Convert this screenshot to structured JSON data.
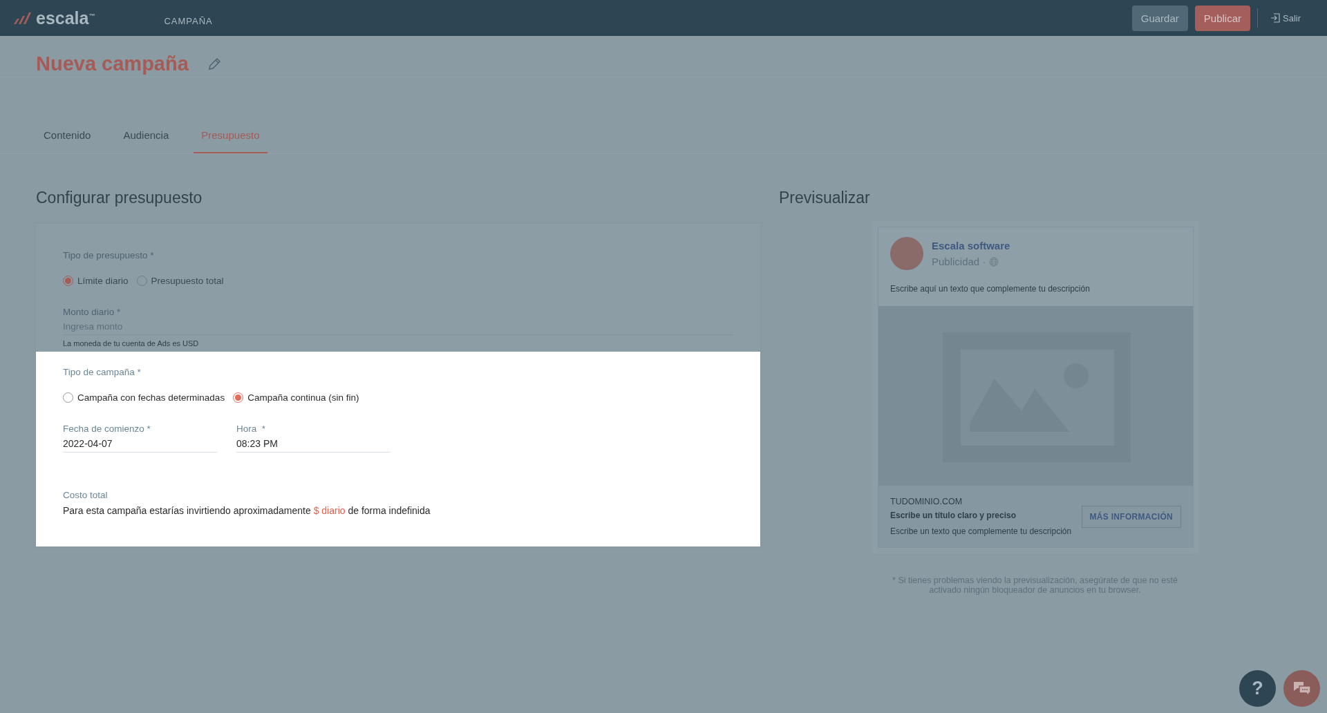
{
  "header": {
    "logo": "escala$^{™}$",
    "section": "CAMPAÑA",
    "buttons": [
      {
        "label": "Guardar",
        "kind": "secondary"
      },
      {
        "label": "Publicar",
        "kind": "primary"
      }
    ],
    "exit": "Salir"
  },
  "page_title": "Nueva campaña",
  "tabs": [
    {
      "label": "Contenido",
      "selected": false
    },
    {
      "label": "Audiencia",
      "selected": false
    },
    {
      "label": "Presupuesto",
      "selected": true
    }
  ],
  "budget": {
    "heading": "Configurar presupuesto",
    "type_label": "Tipo de presupuesto *",
    "type_options": [
      {
        "label": "Límite diario",
        "selected": true
      },
      {
        "label": "Presupuesto total",
        "selected": false
      }
    ],
    "amount": {
      "label": "Monto diario *",
      "placeholder": "Ingresa monto",
      "hint": "La moneda de tu cuenta de Ads es USD"
    }
  },
  "campaign": {
    "type_label": "Tipo de campaña *",
    "type_options": [
      {
        "label": "Campaña con fechas determinadas",
        "selected": false
      },
      {
        "label": "Campaña continua (sin fin)",
        "selected": true
      }
    ],
    "start_date": {
      "label": "Fecha de comienzo *",
      "value": "2022-04-07"
    },
    "time": {
      "label": "Hora  *",
      "value": "08:23 PM"
    },
    "cost_label": "Costo total",
    "cost_before": "Para esta campaña estarías invirtiendo aproximadamente ",
    "cost_amount": "$ diario",
    "cost_after": " de forma indefinida"
  },
  "preview": {
    "heading": "Previsualizar",
    "page_name": "Escala software",
    "sponsored": "Publicidad ·",
    "text": "Escribe aquí un texto que complemente tu descripción",
    "domain": "TUDOMINIO.COM",
    "headline": "Escribe un título claro y preciso",
    "description": "Escribe un texto que complemente tu descripción",
    "cta": "MÁS INFORMACIÓN",
    "note": "* Si tienes problemas viendo la previsualización, asegúrate de que no esté activado ningún bloqueador de anuncios en tu browser."
  },
  "help_button": "?"
}
